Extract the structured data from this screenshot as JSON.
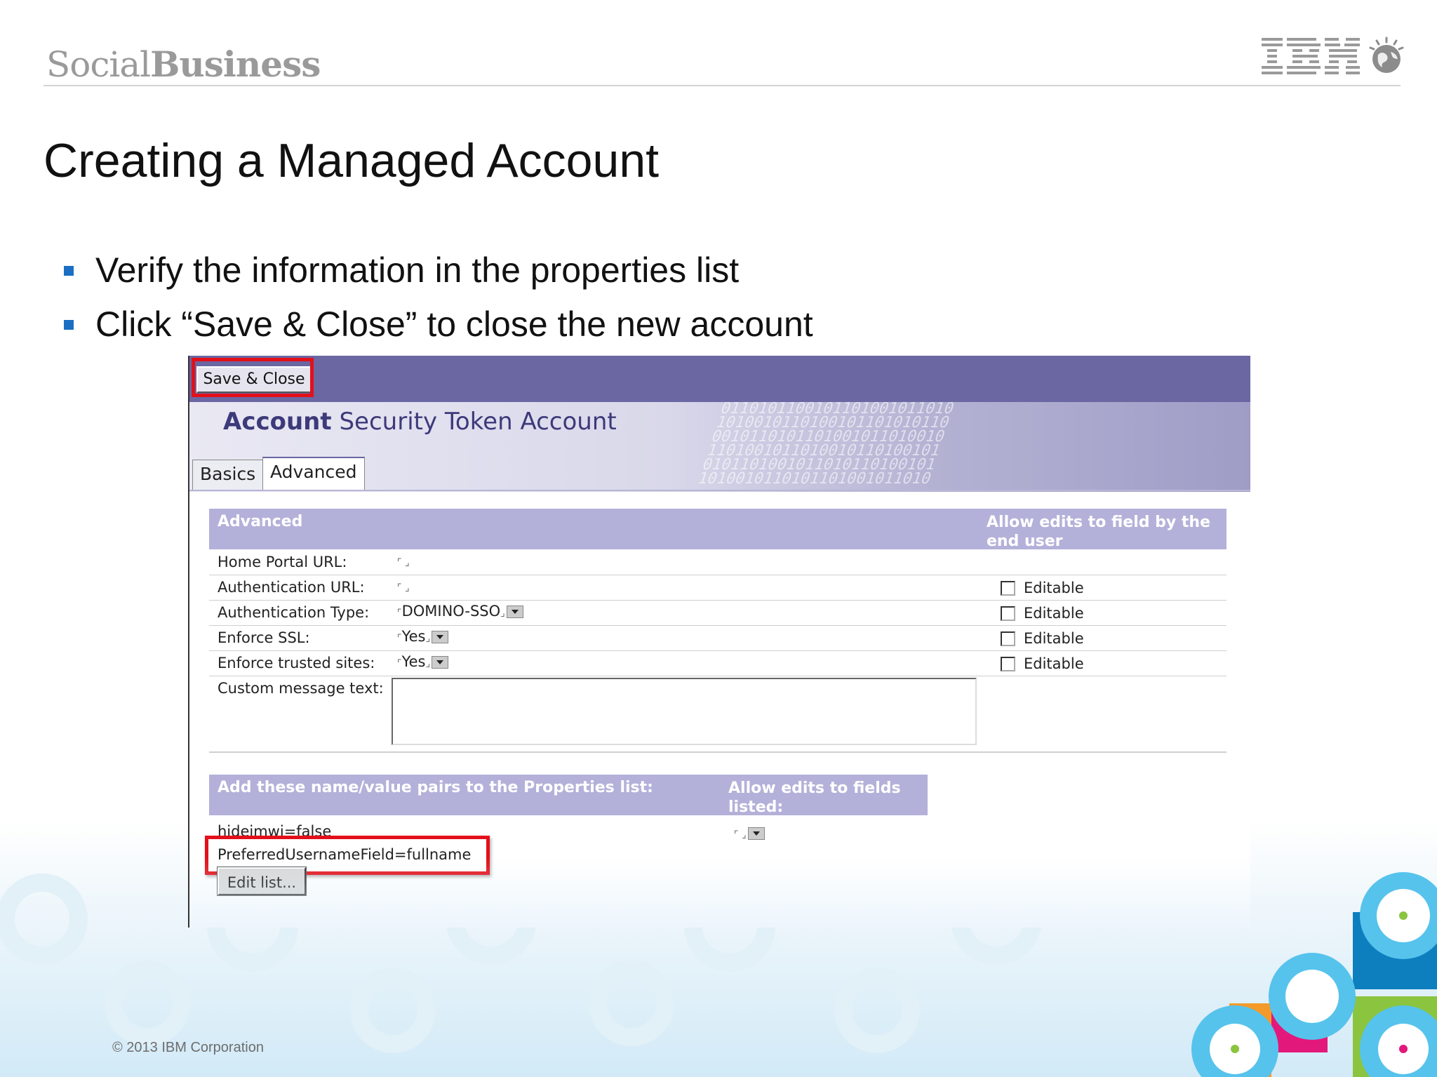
{
  "header": {
    "brand_light": "Social",
    "brand_bold": "Business",
    "ibm_logo": "IBM"
  },
  "slide": {
    "title": "Creating a Managed Account",
    "bullets": [
      "Verify the information in the properties list",
      "Click “Save & Close” to close the new account"
    ],
    "copyright": "© 2013 IBM Corporation"
  },
  "screenshot": {
    "toolbar": {
      "save_close_label": "Save & Close"
    },
    "banner": {
      "title_bold": "Account",
      "title_rest": "Security Token Account"
    },
    "tabs": [
      {
        "label": "Basics",
        "active": false
      },
      {
        "label": "Advanced",
        "active": true
      }
    ],
    "advanced_section": {
      "header": "Advanced",
      "allow_edits_header": "Allow edits to field by the end user",
      "fields": [
        {
          "label": "Home Portal URL:",
          "value": "",
          "editable_label": ""
        },
        {
          "label": "Authentication URL:",
          "value": "",
          "editable_label": "Editable"
        },
        {
          "label": "Authentication Type:",
          "value": "DOMINO-SSO",
          "editable_label": "Editable"
        },
        {
          "label": "Enforce SSL:",
          "value": "Yes",
          "editable_label": "Editable"
        },
        {
          "label": "Enforce trusted sites:",
          "value": "Yes",
          "editable_label": "Editable"
        }
      ],
      "custom_message_label": "Custom message text:",
      "custom_message_value": ""
    },
    "properties_section": {
      "header": "Add these name/value pairs to the Properties list:",
      "allow_edits_header": "Allow edits to fields listed:",
      "items": [
        "hideimwi=false",
        "PreferredUsernameField=fullname"
      ],
      "edit_list_label": "Edit list..."
    }
  },
  "colors": {
    "toolbar": "#6a67a3",
    "section_header": "#b3b1d9",
    "highlight": "#e3101a",
    "bullet": "#1a6fc4"
  }
}
